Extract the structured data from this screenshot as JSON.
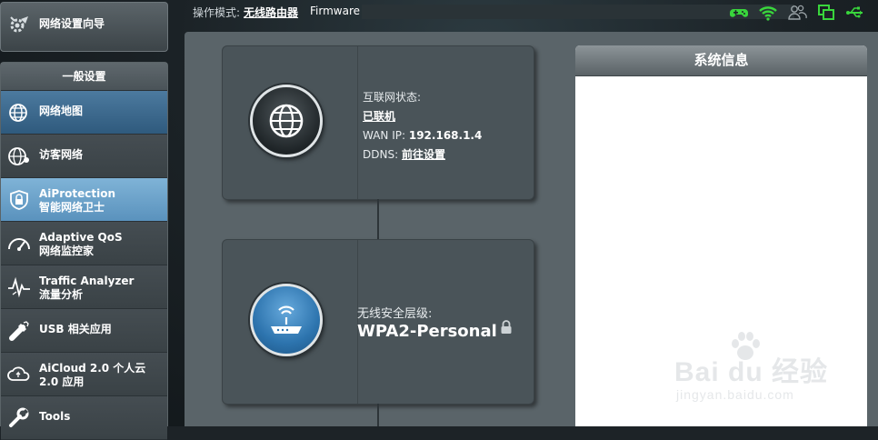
{
  "topbar": {
    "mode_label": "操作模式:",
    "mode_value": "无线路由器",
    "firmware_label": "Firmware"
  },
  "status_icons": [
    "gamepad-icon",
    "wifi-icon",
    "users-icon",
    "copy-icon",
    "usb-icon"
  ],
  "sidebar": {
    "wizard_label": "网络设置向导",
    "section_title": "一般设置",
    "items": [
      {
        "label": "网络地图",
        "icon": "globe-icon"
      },
      {
        "label": "访客网络",
        "icon": "guest-network-icon"
      },
      {
        "label": "AiProtection\n智能网络卫士",
        "line1": "AiProtection",
        "line2": "智能网络卫士",
        "icon": "shield-icon"
      },
      {
        "label": "Adaptive QoS\n网络监控家",
        "line1": "Adaptive QoS",
        "line2": "网络监控家",
        "icon": "speedometer-icon"
      },
      {
        "label": "Traffic Analyzer\n流量分析",
        "line1": "Traffic Analyzer",
        "line2": "流量分析",
        "icon": "traffic-analyzer-icon"
      },
      {
        "label": "USB 相关应用",
        "icon": "usb-apps-icon"
      },
      {
        "label": "AiCloud 2.0 个人云\n2.0 应用",
        "line1": "AiCloud 2.0 个人云",
        "line2": "2.0 应用",
        "icon": "cloud-icon"
      },
      {
        "label": "Tools",
        "icon": "wrench-icon"
      }
    ]
  },
  "internet": {
    "status_label": "互联网状态:",
    "status_value": "已联机",
    "wan_label": "WAN IP:",
    "wan_value": "192.168.1.4",
    "ddns_label": "DDNS:",
    "ddns_value": "前往设置"
  },
  "wireless": {
    "security_label": "无线安全层级:",
    "security_value": "WPA2-Personal"
  },
  "sysinfo": {
    "title": "系统信息"
  },
  "watermark": {
    "text": "Bai du 经验",
    "url": "jingyan.baidu.com"
  },
  "colors": {
    "status_green": "#39d63c",
    "nav_active": "#3d6b91",
    "nav_highlight": "#6ea4cb",
    "router_blue": "#2d74ae"
  }
}
